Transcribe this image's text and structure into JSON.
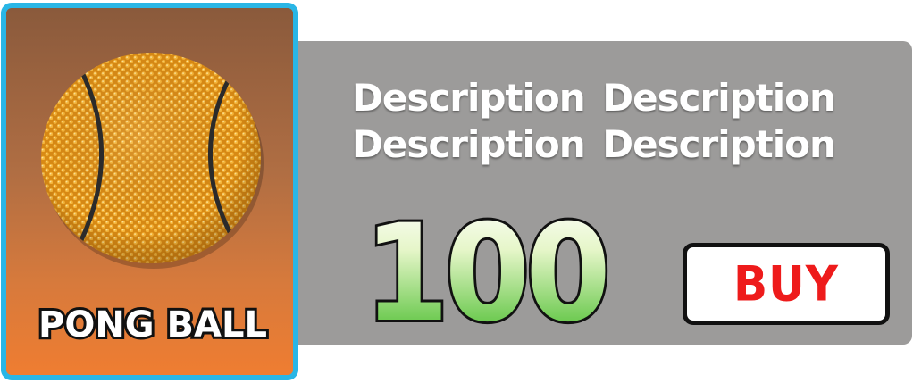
{
  "item": {
    "name": "PONG BALL",
    "icon": "basketball-icon"
  },
  "details": {
    "description": "Description Description Description Description",
    "price": "100"
  },
  "actions": {
    "buy_label": "BUY"
  },
  "colors": {
    "card_border": "#29b6e6",
    "card_gradient_top": "#8a5a3c",
    "card_gradient_bottom": "#ef7d31",
    "panel_background": "#9c9b9a",
    "price_gradient_top": "#ffffff",
    "price_gradient_bottom": "#3cb820",
    "buy_text": "#ee1b1b"
  }
}
